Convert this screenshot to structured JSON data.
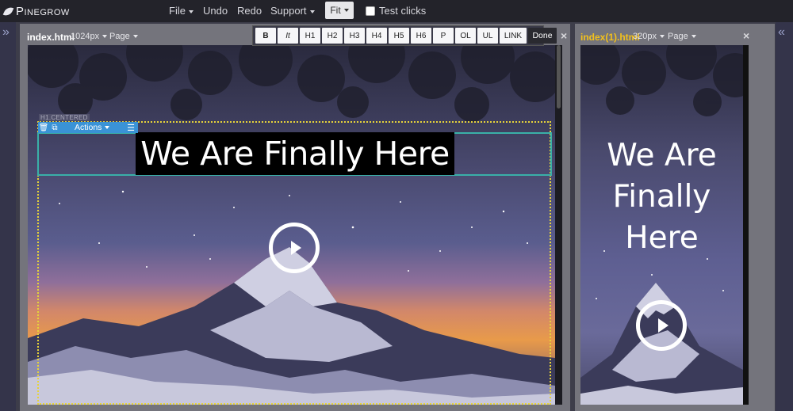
{
  "app": {
    "logo_text": "Pinegrow"
  },
  "menubar": {
    "file": "File",
    "undo": "Undo",
    "redo": "Redo",
    "support": "Support",
    "fit": "Fit",
    "test_clicks": "Test clicks"
  },
  "format_toolbar": {
    "buttons": [
      "B",
      "It",
      "H1",
      "H2",
      "H3",
      "H4",
      "H5",
      "H6",
      "P",
      "OL",
      "UL",
      "LINK"
    ],
    "done": "Done"
  },
  "panels": [
    {
      "file": "index.html",
      "size": "1024px",
      "page_menu": "Page",
      "file_color": "#ffffff",
      "headline": "We Are Finally Here",
      "selection": {
        "tag_label": "H1.CENTERED",
        "actions_label": "Actions"
      }
    },
    {
      "file": "index(1).html",
      "size": "320px",
      "page_menu": "Page",
      "file_color": "#f3c11b",
      "headline": "We Are Finally Here"
    }
  ],
  "colors": {
    "selection_outline": "#e6d33a",
    "element_outline": "#3ab0a8",
    "toolbar_blue": "#3a93d6"
  },
  "icons": {
    "left_rail": "double-chevron-right-icon",
    "right_rail": "double-chevron-left-icon",
    "close": "close-icon",
    "delete": "trash-icon",
    "duplicate": "copy-icon",
    "menu": "hamburger-icon",
    "play": "play-icon"
  }
}
